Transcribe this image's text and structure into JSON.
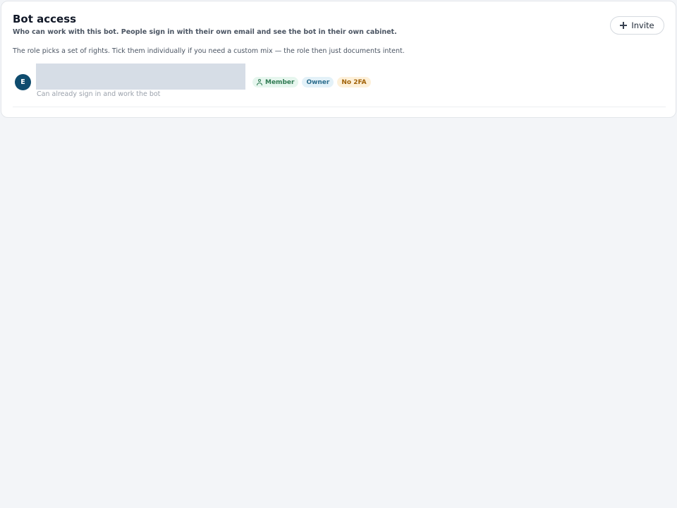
{
  "card": {
    "title": "Bot access",
    "subtitle": "Who can work with this bot. People sign in with their own email and see the bot in their own cabinet.",
    "invite_label": "Invite",
    "note": "The role picks a set of rights. Tick them individually if you need a custom mix — the role then just documents intent."
  },
  "members": [
    {
      "avatar_letter": "E",
      "avatar_color": "#0f4c6e",
      "badges": {
        "member": "Member",
        "owner": "Owner",
        "two_fa": "No 2FA"
      },
      "status": "Can already sign in and work the bot"
    }
  ],
  "colors": {
    "member_badge": "#2f7a52",
    "owner_badge": "#2b6c8c",
    "no_2fa_badge": "#a16207"
  },
  "icons": {
    "invite": "plus-icon",
    "member_badge": "person-icon"
  }
}
